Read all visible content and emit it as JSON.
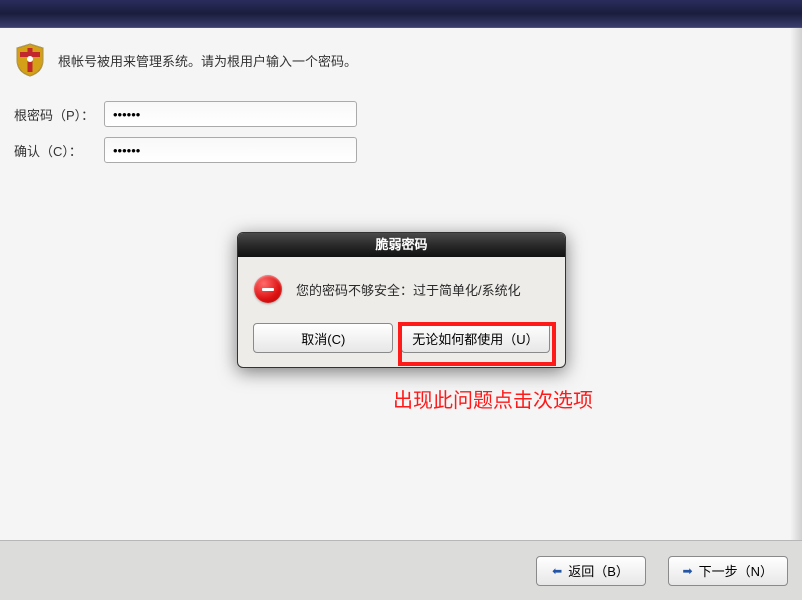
{
  "intro": {
    "text": "根帐号被用来管理系统。请为根用户输入一个密码。"
  },
  "form": {
    "password_label": "根密码（P）：",
    "password_value": "••••••",
    "confirm_label": "确认（C）：",
    "confirm_value": "••••••"
  },
  "dialog": {
    "title": "脆弱密码",
    "message": "您的密码不够安全：过于简单化/系统化",
    "cancel_label": "取消(C)",
    "use_anyway_label": "无论如何都使用（U）"
  },
  "annotation": {
    "text": "出现此问题点击次选项"
  },
  "footer": {
    "back_label": "返回（B）",
    "next_label": "下一步（N）"
  }
}
